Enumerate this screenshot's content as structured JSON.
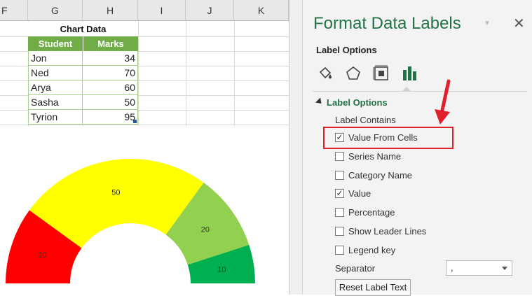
{
  "columns": [
    "F",
    "G",
    "H",
    "I",
    "J",
    "K"
  ],
  "table": {
    "title": "Chart Data",
    "headers": [
      "Student",
      "Marks"
    ],
    "rows": [
      {
        "name": "Jon",
        "marks": "34"
      },
      {
        "name": "Ned",
        "marks": "70"
      },
      {
        "name": "Arya",
        "marks": "60"
      },
      {
        "name": "Sasha",
        "marks": "50"
      },
      {
        "name": "Tyrion",
        "marks": "95"
      }
    ],
    "header_color": "#70ad47"
  },
  "chart_data": {
    "type": "pie",
    "subtype": "half-doughnut gauge",
    "slices": [
      {
        "value": 20,
        "label": "20",
        "color": "#ff0000"
      },
      {
        "value": 50,
        "label": "50",
        "color": "#ffff00"
      },
      {
        "value": 20,
        "label": "20",
        "color": "#92d050"
      },
      {
        "value": 10,
        "label": "10",
        "color": "#00b050"
      }
    ]
  },
  "pane": {
    "title": "Format Data Labels",
    "tab": "Label Options",
    "icons": [
      "fill-line-icon",
      "effects-icon",
      "size-properties-icon",
      "label-options-chart-icon"
    ],
    "section": "Label Options",
    "sub_label": "Label Contains",
    "checkboxes": [
      {
        "label": "Value From Cells",
        "checked": true
      },
      {
        "label": "Series Name",
        "checked": false
      },
      {
        "label": "Category Name",
        "checked": false
      },
      {
        "label": "Value",
        "checked": true
      },
      {
        "label": "Percentage",
        "checked": false
      },
      {
        "label": "Show Leader Lines",
        "checked": false
      },
      {
        "label": "Legend key",
        "checked": false
      }
    ],
    "separator_label": "Separator",
    "separator_value": ",",
    "reset_label": "Reset Label Text",
    "accent": "#217346",
    "highlight": "#e0212b"
  }
}
